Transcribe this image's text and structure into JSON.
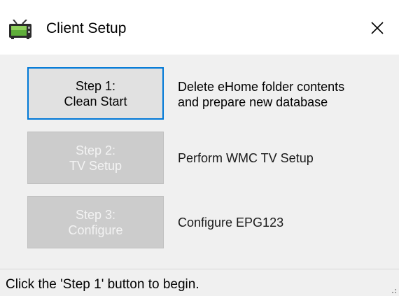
{
  "window": {
    "title": "Client Setup",
    "icon": "tv-icon",
    "close_icon": "close-icon"
  },
  "steps": [
    {
      "line1": "Step 1:",
      "line2": "Clean Start",
      "description_line1": "Delete eHome folder contents",
      "description_line2": "and prepare new database",
      "enabled": true
    },
    {
      "line1": "Step 2:",
      "line2": "TV Setup",
      "description_line1": "Perform WMC TV Setup",
      "description_line2": "",
      "enabled": false
    },
    {
      "line1": "Step 3:",
      "line2": "Configure",
      "description_line1": "Configure EPG123",
      "description_line2": "",
      "enabled": false
    }
  ],
  "statusbar": {
    "text": "Click the 'Step 1' button to begin."
  },
  "colors": {
    "accent": "#0078d7",
    "window_bg": "#f0f0f0",
    "titlebar_bg": "#ffffff",
    "disabled_button_bg": "#cccccc"
  }
}
